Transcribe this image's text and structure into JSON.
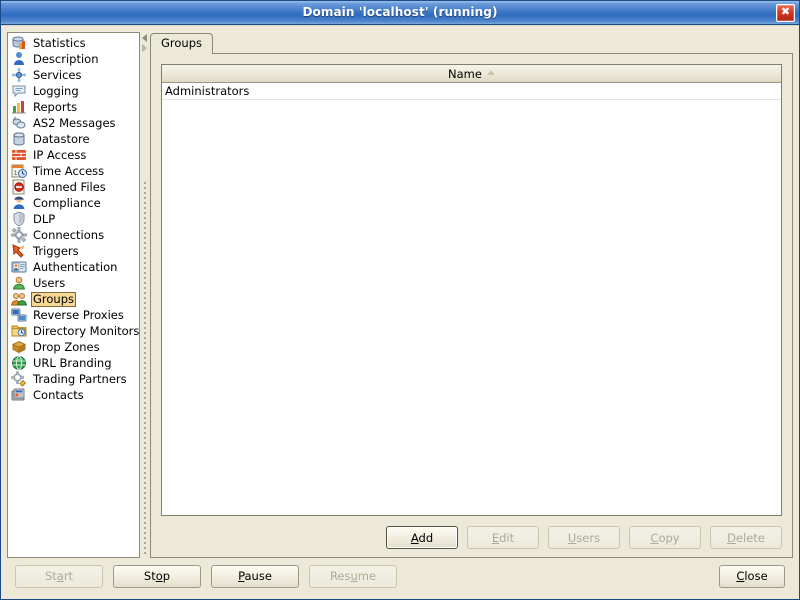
{
  "window": {
    "title": "Domain 'localhost' (running)",
    "close_icon": "close-icon",
    "close_glyph": "✖"
  },
  "sidebar": {
    "items": [
      {
        "label": "Statistics",
        "icon": "statistics-icon",
        "selected": false
      },
      {
        "label": "Description",
        "icon": "description-icon",
        "selected": false
      },
      {
        "label": "Services",
        "icon": "services-icon",
        "selected": false
      },
      {
        "label": "Logging",
        "icon": "logging-icon",
        "selected": false
      },
      {
        "label": "Reports",
        "icon": "reports-icon",
        "selected": false
      },
      {
        "label": "AS2 Messages",
        "icon": "as2-messages-icon",
        "selected": false
      },
      {
        "label": "Datastore",
        "icon": "datastore-icon",
        "selected": false
      },
      {
        "label": "IP Access",
        "icon": "ip-access-icon",
        "selected": false
      },
      {
        "label": "Time Access",
        "icon": "time-access-icon",
        "selected": false
      },
      {
        "label": "Banned Files",
        "icon": "banned-files-icon",
        "selected": false
      },
      {
        "label": "Compliance",
        "icon": "compliance-icon",
        "selected": false
      },
      {
        "label": "DLP",
        "icon": "dlp-icon",
        "selected": false
      },
      {
        "label": "Connections",
        "icon": "connections-icon",
        "selected": false
      },
      {
        "label": "Triggers",
        "icon": "triggers-icon",
        "selected": false
      },
      {
        "label": "Authentication",
        "icon": "authentication-icon",
        "selected": false
      },
      {
        "label": "Users",
        "icon": "users-icon",
        "selected": false
      },
      {
        "label": "Groups",
        "icon": "groups-icon",
        "selected": true
      },
      {
        "label": "Reverse Proxies",
        "icon": "reverse-proxies-icon",
        "selected": false
      },
      {
        "label": "Directory Monitors",
        "icon": "directory-monitors-icon",
        "selected": false
      },
      {
        "label": "Drop Zones",
        "icon": "drop-zones-icon",
        "selected": false
      },
      {
        "label": "URL Branding",
        "icon": "url-branding-icon",
        "selected": false
      },
      {
        "label": "Trading Partners",
        "icon": "trading-partners-icon",
        "selected": false
      },
      {
        "label": "Contacts",
        "icon": "contacts-icon",
        "selected": false
      }
    ]
  },
  "splitter": {
    "collapse_left_icon": "triangle-left-icon",
    "collapse_right_icon": "triangle-right-icon"
  },
  "tabs": [
    {
      "label": "Groups",
      "active": true
    }
  ],
  "table": {
    "columns": [
      {
        "label": "Name",
        "sort": "ascending",
        "sort_icon": "sort-ascending-icon"
      }
    ],
    "rows": [
      {
        "name": "Administrators"
      }
    ]
  },
  "action_buttons": [
    {
      "label": "Add",
      "mnemonic": "A",
      "enabled": true,
      "default": true
    },
    {
      "label": "Edit",
      "mnemonic": "E",
      "enabled": false,
      "default": false
    },
    {
      "label": "Users",
      "mnemonic": "U",
      "enabled": false,
      "default": false
    },
    {
      "label": "Copy",
      "mnemonic": "C",
      "enabled": false,
      "default": false
    },
    {
      "label": "Delete",
      "mnemonic": "D",
      "enabled": false,
      "default": false
    }
  ],
  "bottom_buttons": [
    {
      "label": "Start",
      "mnemonic": "a",
      "enabled": false
    },
    {
      "label": "Stop",
      "mnemonic": "o",
      "enabled": true
    },
    {
      "label": "Pause",
      "mnemonic": "P",
      "enabled": true
    },
    {
      "label": "Resume",
      "mnemonic": "u",
      "enabled": false
    }
  ],
  "close_button": {
    "label": "Close",
    "mnemonic": "C",
    "enabled": true
  },
  "colors": {
    "titlebar_blue": "#2f6cbf",
    "window_face": "#ece9d8",
    "selection_highlight": "#f7d794",
    "close_red": "#d33a28",
    "list_background": "#ffffff"
  }
}
